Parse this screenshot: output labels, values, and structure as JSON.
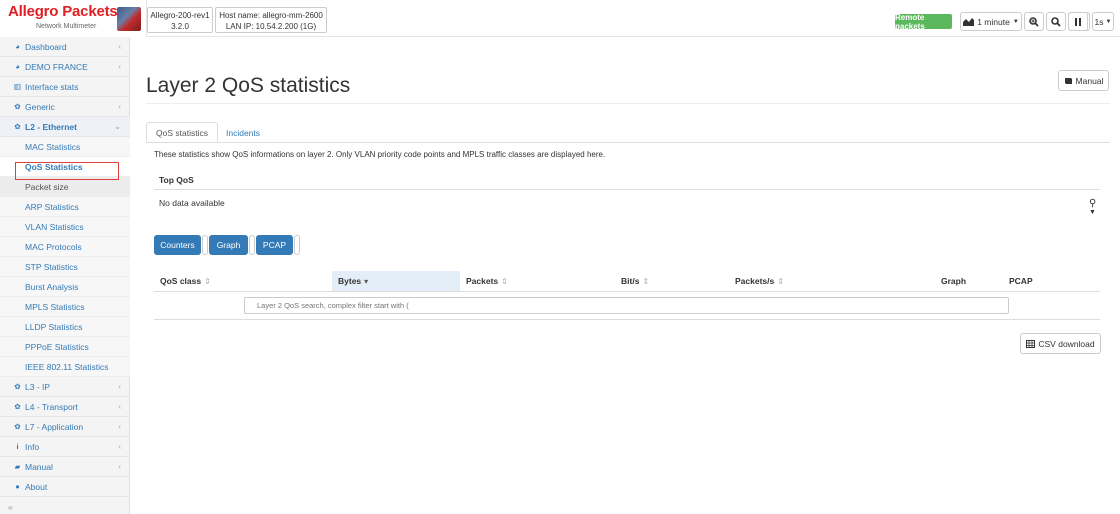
{
  "brand": {
    "title": "Allegro Packets",
    "subtitle": "Network Multimeter"
  },
  "device": {
    "model": "Allegro-200-rev1",
    "version": "3.2.0",
    "host": "Host name: allegro-mm-2600",
    "lan_ip": "LAN IP: 10.54.2.200 (1G)"
  },
  "toolbar": {
    "remote_packets": "Remote packets",
    "interval": "1 minute",
    "refresh": "1s"
  },
  "sidebar": {
    "items": [
      {
        "label": "Dashboard",
        "icon": "dashboard-icon"
      },
      {
        "label": "DEMO FRANCE",
        "icon": "dashboard-icon"
      },
      {
        "label": "Interface stats",
        "icon": "bar-chart-icon"
      },
      {
        "label": "Generic",
        "icon": "gear-icon"
      },
      {
        "label": "L2 - Ethernet",
        "icon": "gear-icon"
      }
    ],
    "sub_items": [
      "MAC Statistics",
      "QoS Statistics",
      "Packet size",
      "ARP Statistics",
      "VLAN Statistics",
      "MAC Protocols",
      "STP Statistics",
      "Burst Analysis",
      "MPLS Statistics",
      "LLDP Statistics",
      "PPPoE Statistics",
      "IEEE 802.11 Statistics"
    ],
    "bottom_items": [
      {
        "label": "L3 - IP",
        "icon": "gear-icon"
      },
      {
        "label": "L4 - Transport",
        "icon": "gear-icon"
      },
      {
        "label": "L7 - Application",
        "icon": "gear-icon"
      },
      {
        "label": "Info",
        "icon": "info-icon"
      },
      {
        "label": "Manual",
        "icon": "book-icon"
      },
      {
        "label": "About",
        "icon": "info-circle-icon"
      }
    ],
    "collapse": "«"
  },
  "main": {
    "title": "Layer 2 QoS statistics",
    "manual_label": "Manual",
    "tabs": [
      "QoS statistics",
      "Incidents"
    ],
    "description": "These statistics show QoS informations on layer 2. Only VLAN priority code points and MPLS traffic classes are displayed here.",
    "top_qos_label": "Top QoS",
    "no_data": "No data available",
    "view_buttons": [
      "Counters",
      "Graph",
      "PCAP"
    ],
    "columns": [
      "QoS class",
      "Bytes",
      "Packets",
      "Bit/s",
      "Packets/s",
      "Graph",
      "PCAP"
    ],
    "search_placeholder": "Layer 2 QoS search, complex filter start with (",
    "csv_label": "CSV download"
  }
}
